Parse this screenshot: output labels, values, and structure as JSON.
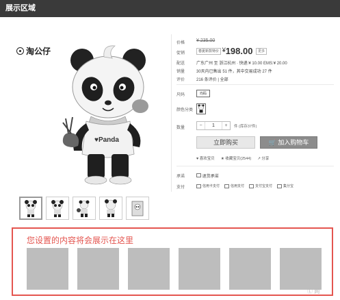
{
  "header": {
    "title": "展示区域"
  },
  "brand": {
    "name": "淘公仔"
  },
  "product": {
    "price_label": "价格",
    "original_price": "¥ 235.00",
    "promo_label": "促销",
    "promo_tag": "春夏新款特价",
    "currency": "¥",
    "promo_price": "198.00",
    "promo_chip": "更多",
    "shipping_label": "配送",
    "shipping_text": "广东广州 至 浙江杭州 ·  快递:¥ 10.00   EMS:¥ 20.00",
    "sales_label": "销量",
    "sales_text": "30天内已售出 51 件，其中交易成功 27 件",
    "rating_label": "评价",
    "rating_text": "216 条评价 | 全部",
    "size_label": "尺码",
    "size_option": "均码",
    "color_label": "颜色分类",
    "qty_label": "数量",
    "qty_minus": "−",
    "qty_value": "1",
    "qty_plus": "+",
    "stock_text": "件 (库存37件)",
    "buy_now": "立即购买",
    "add_to_cart": "加入购物车",
    "favorite": "喜欢宝贝",
    "collect": "收藏宝贝(2544)",
    "share": "分享",
    "service_label": "承诺",
    "service_text": "退货承诺",
    "payment_label": "支付",
    "payments": [
      "信用卡支付",
      "信用支付",
      "支付宝支付",
      "集分宝"
    ]
  },
  "showcase": {
    "title": "您设置的内容将会展示在这里"
  },
  "watermark": "Ⓛ 网"
}
